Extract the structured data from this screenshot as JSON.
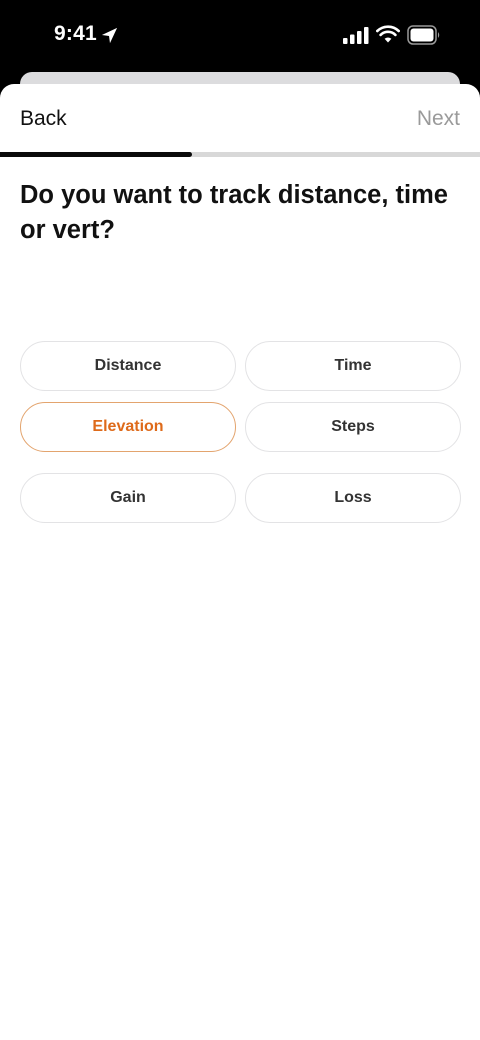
{
  "status_bar": {
    "time": "9:41",
    "icons": [
      "location-arrow-icon",
      "cellular-signal-icon",
      "wifi-icon",
      "battery-icon"
    ]
  },
  "nav": {
    "back_label": "Back",
    "next_label": "Next"
  },
  "progress": {
    "fraction": 0.4
  },
  "question": "Do you want to track distance, time or vert?",
  "options": [
    {
      "label": "Distance",
      "selected": false
    },
    {
      "label": "Time",
      "selected": false
    },
    {
      "label": "Elevation",
      "selected": true
    },
    {
      "label": "Steps",
      "selected": false
    },
    {
      "label": "Gain",
      "selected": false
    },
    {
      "label": "Loss",
      "selected": false
    }
  ],
  "colors": {
    "accent": "#de6a1a",
    "accent_border": "#e3a46e",
    "progress_fill": "#0a0a0a",
    "progress_track": "#d8d8d8",
    "disabled_text": "#9a9a9a"
  }
}
